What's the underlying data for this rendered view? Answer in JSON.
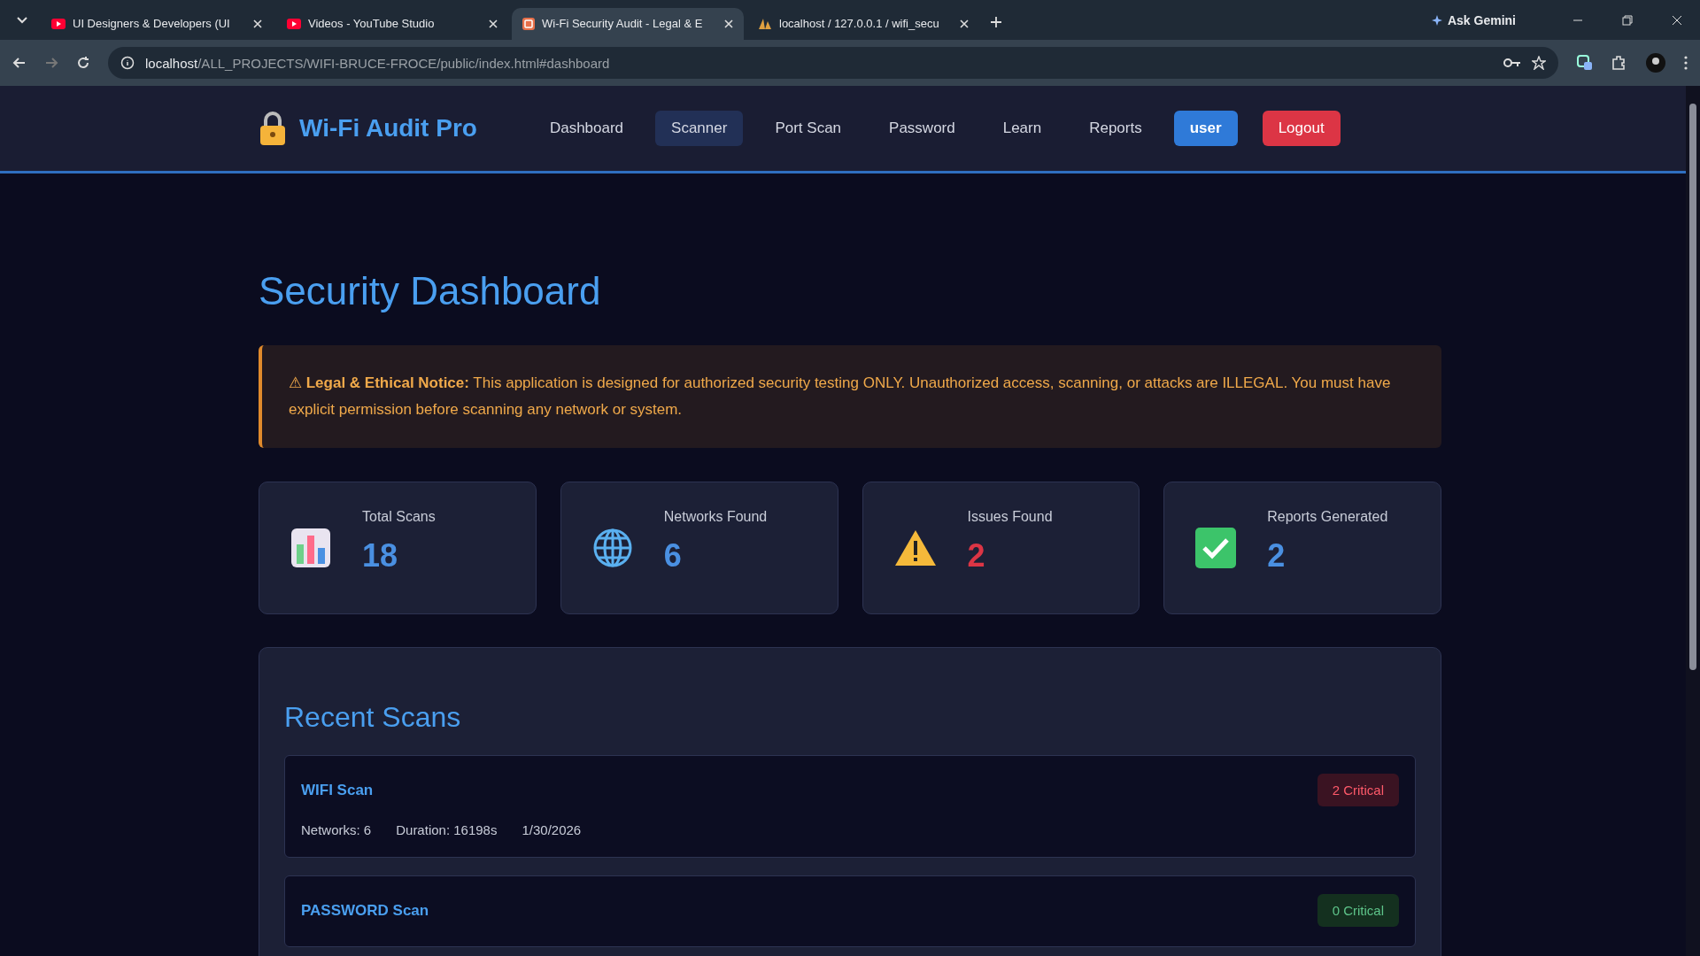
{
  "browser": {
    "tabs": [
      {
        "title": "UI Designers & Developers (UI",
        "kind": "video",
        "selected": false
      },
      {
        "title": "Videos - YouTube Studio",
        "kind": "video",
        "selected": false
      },
      {
        "title": "Wi-Fi Security Audit - Legal & E",
        "kind": "app",
        "selected": true
      },
      {
        "title": "localhost / 127.0.0.1 / wifi_secu",
        "kind": "db",
        "selected": false
      }
    ],
    "gemini": "Ask Gemini",
    "url_host": "localhost",
    "url_path": "/ALL_PROJECTS/WIFI-BRUCE-FROCE/public/index.html#dashboard"
  },
  "header": {
    "brand": "Wi-Fi Audit Pro",
    "nav": [
      {
        "label": "Dashboard",
        "selected": false
      },
      {
        "label": "Scanner",
        "selected": true
      },
      {
        "label": "Port Scan",
        "selected": false
      },
      {
        "label": "Password",
        "selected": false
      },
      {
        "label": "Learn",
        "selected": false
      },
      {
        "label": "Reports",
        "selected": false
      }
    ],
    "user": "user",
    "logout": "Logout"
  },
  "title": "Security Dashboard",
  "notice": {
    "icon": "⚠",
    "text": "**Legal & Ethical Notice:** This application is designed for authorized security testing ONLY. Unauthorized access, scanning, or attacks are ILLEGAL. You must have explicit permission before scanning any network or system."
  },
  "stats": [
    {
      "kind": "chart",
      "label": "Total Scans",
      "value": "18",
      "color": "#4a90e2"
    },
    {
      "kind": "globe",
      "label": "Networks Found",
      "value": "6",
      "color": "#4a90e2"
    },
    {
      "kind": "warning",
      "label": "Issues Found",
      "value": "2",
      "color": "#dc3545"
    },
    {
      "kind": "check",
      "label": "Reports Generated",
      "value": "2",
      "color": "#4a90e2"
    }
  ],
  "recent": {
    "title": "Recent Scans",
    "scans": [
      {
        "name": "WIFI Scan",
        "badge": "2 Critical",
        "kind": "critical",
        "meta": [
          "Networks: 6",
          "Duration: 16198s",
          "1/30/2026"
        ]
      },
      {
        "name": "PASSWORD Scan",
        "badge": "0 Critical",
        "kind": "clear"
      }
    ]
  }
}
